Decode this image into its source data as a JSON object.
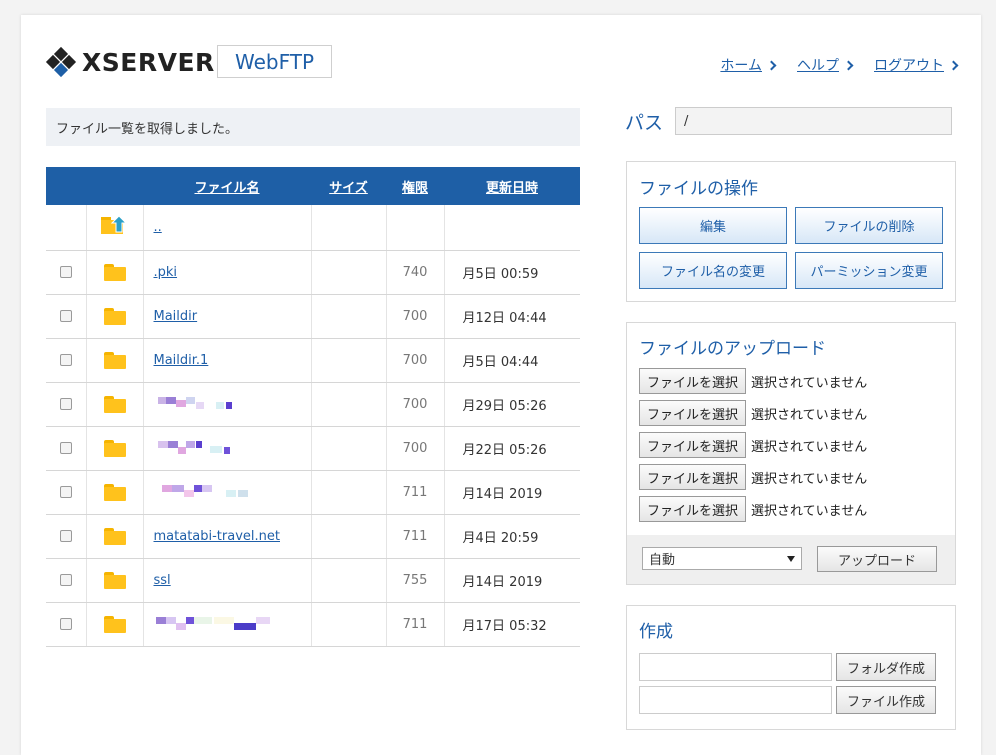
{
  "header": {
    "logo_text": "XSERVER",
    "product": "WebFTP",
    "nav": [
      {
        "label": "ホーム"
      },
      {
        "label": "ヘルプ"
      },
      {
        "label": "ログアウト"
      }
    ]
  },
  "message": "ファイル一覧を取得しました。",
  "table": {
    "columns": [
      "ファイル名",
      "サイズ",
      "権限",
      "更新日時"
    ],
    "parent": "..",
    "rows": [
      {
        "name": ".pki",
        "perm": "740",
        "date": "月5日 00:59"
      },
      {
        "name": "Maildir",
        "perm": "700",
        "date": "月12日 04:44"
      },
      {
        "name": "Maildir.1",
        "perm": "700",
        "date": "月5日 04:44"
      },
      {
        "name": "",
        "perm": "700",
        "date": "月29日 05:26"
      },
      {
        "name": "",
        "perm": "700",
        "date": "月22日 05:26"
      },
      {
        "name": "",
        "perm": "711",
        "date": "月14日 2019"
      },
      {
        "name": "matatabi-travel.net",
        "perm": "711",
        "date": "月4日 20:59"
      },
      {
        "name": "ssl",
        "perm": "755",
        "date": "月14日 2019"
      },
      {
        "name": "",
        "perm": "711",
        "date": "月17日 05:32"
      }
    ]
  },
  "path": {
    "label": "パス",
    "value": "/"
  },
  "operations": {
    "title": "ファイルの操作",
    "edit": "編集",
    "delete": "ファイルの削除",
    "rename": "ファイル名の変更",
    "permission": "パーミッション変更"
  },
  "upload": {
    "title": "ファイルのアップロード",
    "choose_label": "ファイルを選択",
    "none_selected": "選択されていません",
    "mode": "自動",
    "upload_button": "アップロード"
  },
  "create": {
    "title": "作成",
    "folder_button": "フォルダ作成",
    "file_button": "ファイル作成"
  },
  "colors": {
    "accent": "#1e5fa6",
    "folder": "#ffc21c"
  }
}
